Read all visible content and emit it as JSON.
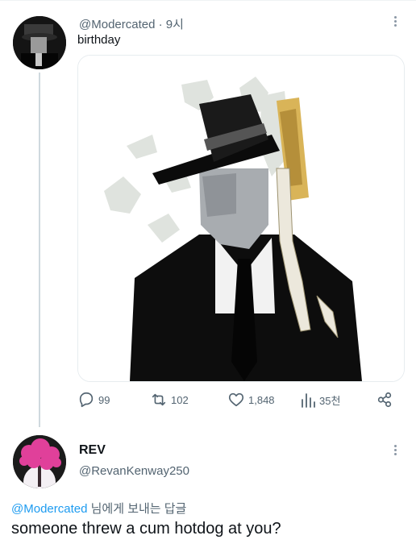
{
  "tweet": {
    "handle": "@Modercated",
    "time": "· 9시",
    "text": "birthday",
    "stats": {
      "replies": "99",
      "retweets": "102",
      "likes": "1,848",
      "views": "35천"
    }
  },
  "reply": {
    "name": "REV",
    "handle": "@RevanKenway250",
    "replying_to_mention": "@Modercated",
    "replying_to_rest": " 님에게 보내는 답글",
    "text": "someone threw a cum hotdog at you?"
  },
  "icons": [
    "more-icon",
    "reply-icon",
    "retweet-icon",
    "like-icon",
    "views-icon",
    "share-icon"
  ],
  "colors": {
    "link": "#1d9bf0",
    "secondary": "#536471",
    "text": "#0f1419",
    "thread_line": "#cfd9de"
  }
}
